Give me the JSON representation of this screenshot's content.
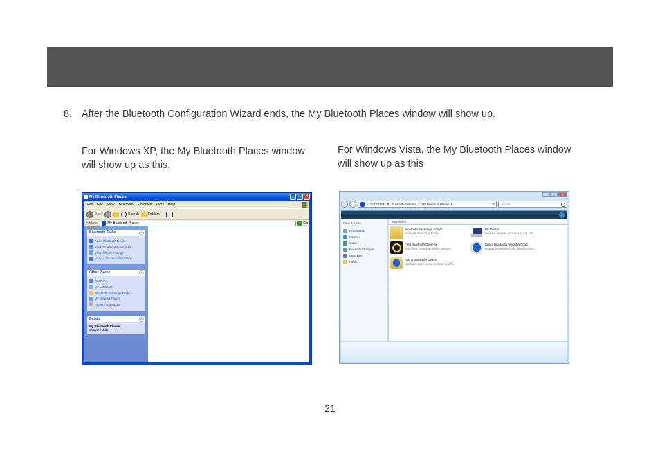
{
  "step": {
    "number": "8.",
    "text": "After the Bluetooth Configuration Wizard ends, the My Bluetooth Places window will show up."
  },
  "captions": {
    "xp": "For Windows XP, the My Bluetooth Places window will show up as this.",
    "vista": "For Windows Vista, the My Bluetooth Places window will show up as this"
  },
  "page_number": "21",
  "xp_window": {
    "title": "My Bluetooth Places",
    "menu": [
      "File",
      "Edit",
      "View",
      "Bluetooth",
      "Favorites",
      "Tools",
      "Help"
    ],
    "toolbar": {
      "back": "Back",
      "search": "Search",
      "folders": "Folders"
    },
    "address_label": "Address",
    "address_value": "My Bluetooth Places",
    "go_label": "Go",
    "panels": {
      "bluetooth_tasks": {
        "title": "Bluetooth Tasks",
        "items": [
          "Add a Bluetooth Device",
          "View My Bluetooth services",
          "View devices in range",
          "View or modify configuration"
        ]
      },
      "other_places": {
        "title": "Other Places",
        "items": [
          "Desktop",
          "My Computer",
          "Bluetooth Exchange Folder",
          "My Network Places",
          "Printers and Faxes"
        ]
      },
      "details": {
        "title": "Details",
        "name": "My Bluetooth Places",
        "type": "System Folder"
      }
    }
  },
  "vista_window": {
    "breadcrumb": [
      "WIDCOMM",
      "Bluetooth Software",
      "My Bluetooth Places"
    ],
    "search_placeholder": "Search",
    "favorites_title": "Favorite Links",
    "favorites": [
      "Documents",
      "Pictures",
      "Music",
      "Recently Changed",
      "Searches",
      "Public"
    ],
    "group_title": "My Device",
    "items": [
      {
        "title": "Bluetooth Exchange Folder",
        "subtitle": "Bluetooth Exchange Folder",
        "icon": "folder-icon"
      },
      {
        "title": "My Device",
        "subtitle": "View the services provided by this com...",
        "icon": "laptop-icon"
      },
      {
        "title": "Find Bluetooth Devices",
        "subtitle": "Search for nearby Bluetooth devices.",
        "icon": "find-devices-icon"
      },
      {
        "title": "Entire Bluetooth Neighborhood",
        "subtitle": "Display previously found Bluetooth dev...",
        "icon": "bluetooth-icon"
      },
      {
        "title": "Add a Bluetooth Device",
        "subtitle": "Configure devices, connections and ho...",
        "icon": "add-bluetooth-icon"
      }
    ]
  },
  "colors": {
    "header_bar": "#555555",
    "xp_link": "#215dc6",
    "vista_link": "#1c3f95"
  }
}
